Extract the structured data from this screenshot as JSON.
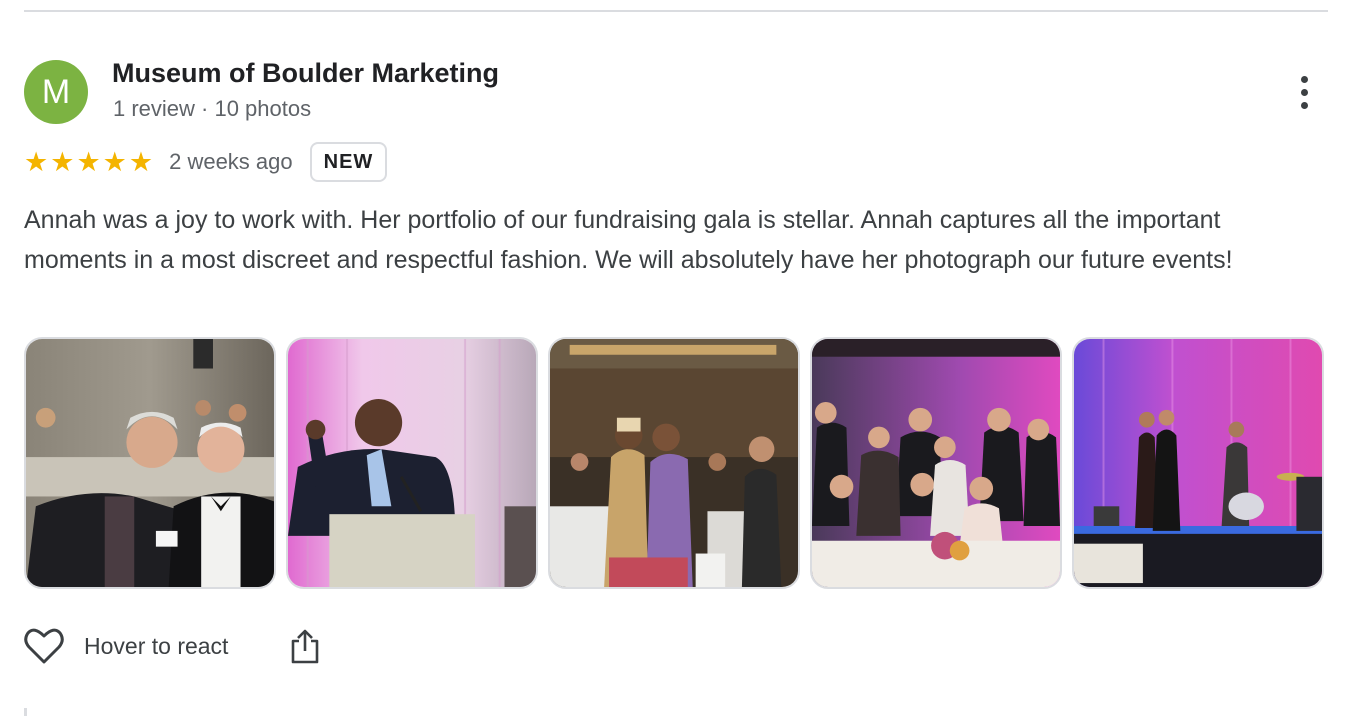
{
  "review": {
    "author": {
      "initial": "M",
      "name": "Museum of Boulder Marketing",
      "meta": "1 review · 10 photos",
      "avatar_color": "#7cb342"
    },
    "rating": {
      "stars": 5,
      "max": 5,
      "star_color": "#f4b400"
    },
    "timestamp": "2 weeks ago",
    "badge": "NEW",
    "text": "Annah was a joy to work with. Her portfolio of our fundraising gala is stellar. Annah captures all the important moments in a most discreet and respectful fashion. We will absolutely have her photograph our future events!",
    "photos": [
      {
        "subject": "two men smiling at gala table"
      },
      {
        "subject": "speaker at podium with pink lights"
      },
      {
        "subject": "guests mingling in ballroom"
      },
      {
        "subject": "group photo at dinner table"
      },
      {
        "subject": "band performing on stage"
      }
    ]
  },
  "actions": {
    "react_label": "Hover to react",
    "react_icon": "heart-outline-icon",
    "share_icon": "share-icon",
    "more_icon": "more-vert-icon"
  }
}
